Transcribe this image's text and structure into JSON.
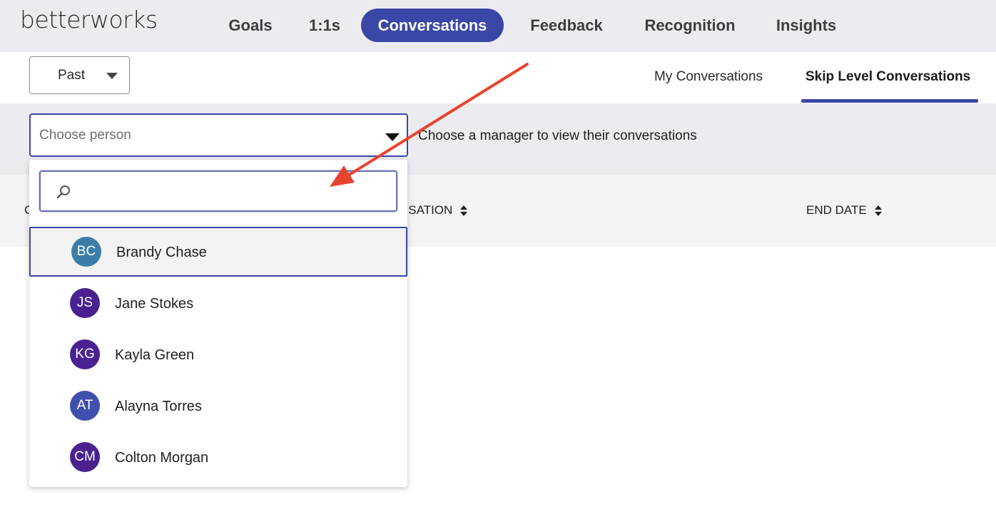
{
  "app": {
    "logo": "betterworks"
  },
  "nav": {
    "items": [
      {
        "label": "Goals"
      },
      {
        "label": "1:1s"
      },
      {
        "label": "Conversations",
        "active": true
      },
      {
        "label": "Feedback"
      },
      {
        "label": "Recognition"
      },
      {
        "label": "Insights"
      }
    ]
  },
  "filter": {
    "selected": "Past"
  },
  "tabs": [
    {
      "label": "My Conversations"
    },
    {
      "label": "Skip Level Conversations",
      "active": true
    }
  ],
  "person_select": {
    "placeholder": "Choose person",
    "help_text": "Choose a manager to view their conversations"
  },
  "table": {
    "columns": [
      {
        "label": "C"
      },
      {
        "label": "RSATION"
      },
      {
        "label": "END DATE"
      }
    ]
  },
  "dropdown": {
    "search_value": "",
    "people": [
      {
        "initials": "BC",
        "name": "Brandy Chase",
        "color": "#3a7ea8",
        "selected": true
      },
      {
        "initials": "JS",
        "name": "Jane Stokes",
        "color": "#4a2290"
      },
      {
        "initials": "KG",
        "name": "Kayla Green",
        "color": "#4a2290"
      },
      {
        "initials": "AT",
        "name": "Alayna Torres",
        "color": "#3f4fae"
      },
      {
        "initials": "CM",
        "name": "Colton Morgan",
        "color": "#4a2290"
      }
    ]
  },
  "colors": {
    "accent": "#3a47a6",
    "annotation_arrow": "#e8432e"
  }
}
